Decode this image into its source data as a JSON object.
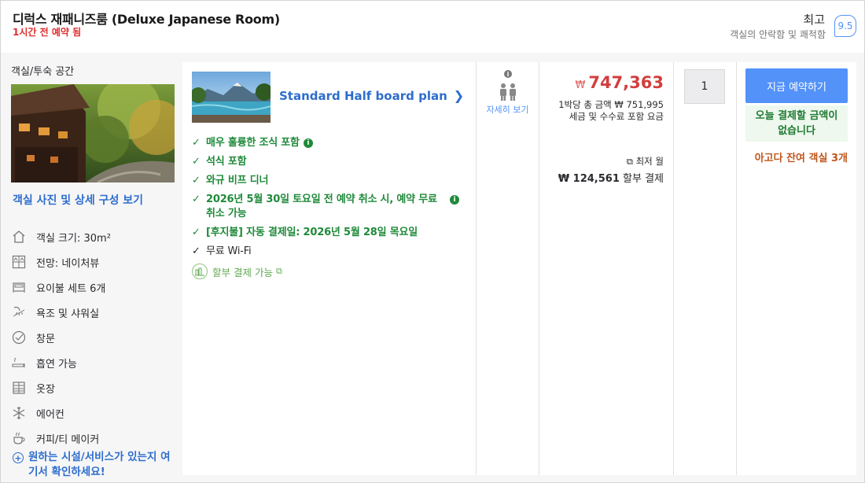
{
  "header": {
    "room_title": "디럭스 재패니즈룸 (Deluxe Japanese Room)",
    "booked_note": "1시간 전 예약 됨",
    "rating_word": "최고",
    "rating_sub": "객실의 안락함 및 쾌적함",
    "rating_score": "9.5"
  },
  "left": {
    "label": "객실/투숙 공간",
    "photos_link": "객실 사진 및 상세 구성 보기",
    "amenities": [
      {
        "icon": "room-size-icon",
        "label": "객실 크기: 30m²"
      },
      {
        "icon": "view-icon",
        "label": "전망: 네이처뷰"
      },
      {
        "icon": "futon-icon",
        "label": "요이불 세트 6개"
      },
      {
        "icon": "shower-icon",
        "label": "욕조 및 샤워실"
      },
      {
        "icon": "window-icon",
        "label": "창문"
      },
      {
        "icon": "smoking-icon",
        "label": "흡연 가능"
      },
      {
        "icon": "wardrobe-icon",
        "label": "옷장"
      },
      {
        "icon": "air-conditioner-icon",
        "label": "에어컨"
      },
      {
        "icon": "coffee-maker-icon",
        "label": "커피/티 메이커"
      }
    ],
    "more_link": "원하는 시설/서비스가 있는지 여기서 확인하세요!"
  },
  "plan": {
    "name": "Standard Half board plan",
    "benefits": [
      {
        "text": "매우 훌륭한 조식 포함",
        "style": "green",
        "info": "inline"
      },
      {
        "text": "석식 포함",
        "style": "green",
        "info": ""
      },
      {
        "text": "와규 비프 디너",
        "style": "green",
        "info": ""
      },
      {
        "text": "2026년 5월 30일 토요일 전 예약 취소 시, 예약 무료 취소 가능",
        "style": "green",
        "info": "right"
      },
      {
        "text": "[후지불] 자동 결제일: 2026년 5월 28일 목요일",
        "style": "green",
        "info": ""
      },
      {
        "text": "무료 Wi-Fi",
        "style": "plain",
        "info": ""
      }
    ],
    "installment_label": "할부 결제 가능"
  },
  "occupancy": {
    "details_link": "자세히 보기"
  },
  "price": {
    "currency": "₩",
    "amount": "747,363",
    "per_night_total": "1박당 총 금액 ₩ 751,995",
    "tax_note": "세금 및 수수료 포함 요금",
    "installment_label": "최저 월",
    "installment_amount": "₩ 124,561",
    "installment_suffix": "할부 결제"
  },
  "quantity": {
    "value": "1"
  },
  "cta": {
    "book_label": "지금 예약하기",
    "pay_today": "오늘 결제할 금액이 없습니다",
    "rooms_left": "아고다 잔여 객실 3개"
  },
  "colors": {
    "brand_blue": "#5392f9",
    "price_red": "#d23e3e",
    "benefit_green": "#1f8a3a",
    "urgency_orange": "#c0561b"
  }
}
